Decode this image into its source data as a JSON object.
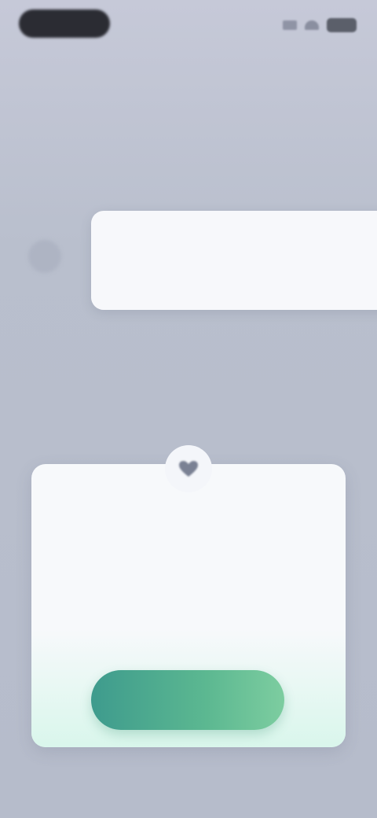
{
  "status_bar": {
    "icons": [
      "signal-icon",
      "wifi-icon",
      "battery-icon"
    ]
  },
  "notice": {
    "title": "",
    "subtitle": "",
    "icon": "avatar-icon"
  },
  "dialog": {
    "badge_icon": "heart-icon",
    "title": "",
    "body": "",
    "primary_button_label": ""
  },
  "colors": {
    "background": "#b9bfcd",
    "card": "#f7f8fb",
    "accent_start": "#3e9b8d",
    "accent_end": "#7dcda0"
  }
}
